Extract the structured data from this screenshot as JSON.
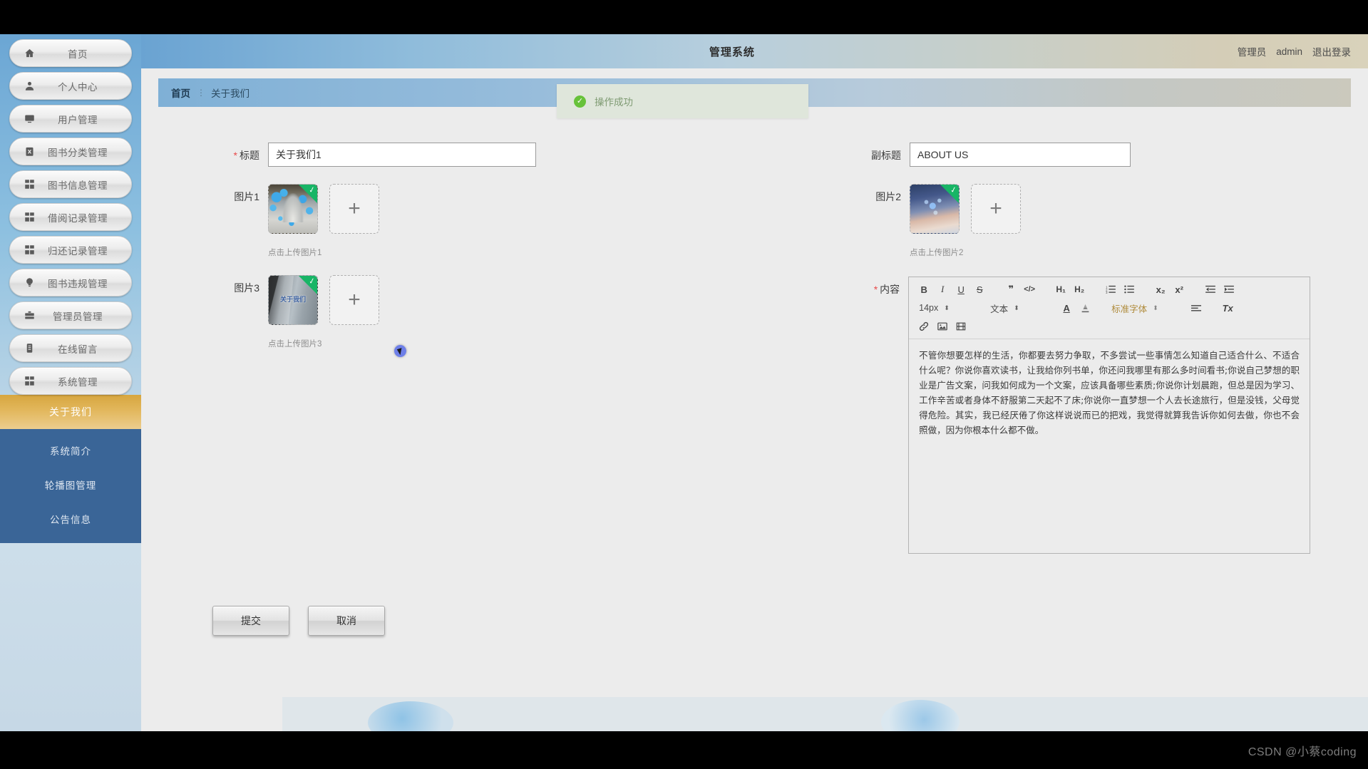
{
  "header": {
    "system_title": "管理系统",
    "role_label": "管理员",
    "username": "admin",
    "logout_label": "退出登录"
  },
  "toast": {
    "message": "操作成功",
    "icon": "check-circle-icon",
    "color": "#67c23a"
  },
  "breadcrumb": {
    "home": "首页",
    "separator": "⋮",
    "current": "关于我们"
  },
  "sidebar": {
    "items": [
      {
        "label": "首页",
        "icon": "home-icon"
      },
      {
        "label": "个人中心",
        "icon": "user-icon"
      },
      {
        "label": "用户管理",
        "icon": "monitor-icon"
      },
      {
        "label": "图书分类管理",
        "icon": "clipboard-x-icon"
      },
      {
        "label": "图书信息管理",
        "icon": "grid-icon"
      },
      {
        "label": "借阅记录管理",
        "icon": "grid-icon"
      },
      {
        "label": "归还记录管理",
        "icon": "grid-icon"
      },
      {
        "label": "图书违规管理",
        "icon": "bulb-icon"
      },
      {
        "label": "管理员管理",
        "icon": "briefcase-icon"
      },
      {
        "label": "在线留言",
        "icon": "clipboard-icon"
      },
      {
        "label": "系统管理",
        "icon": "grid-icon"
      }
    ],
    "active_group": "关于我们",
    "submenu": [
      {
        "label": "系统简介"
      },
      {
        "label": "轮播图管理"
      },
      {
        "label": "公告信息"
      }
    ],
    "active_color": "#d7a63f",
    "submenu_color": "#3a6597"
  },
  "form": {
    "title_field": {
      "label": "标题",
      "required": true,
      "value": "关于我们1",
      "placeholder": "标题"
    },
    "subtitle_field": {
      "label": "副标题",
      "required": false,
      "value": "ABOUT US",
      "placeholder": "副标题"
    },
    "image1": {
      "label": "图片1",
      "hint": "点击上传图片1",
      "add_icon": "plus-icon",
      "badge": "check-badge"
    },
    "image2": {
      "label": "图片2",
      "hint": "点击上传图片2",
      "add_icon": "plus-icon",
      "badge": "check-badge"
    },
    "image3": {
      "label": "图片3",
      "hint": "点击上传图片3",
      "add_icon": "plus-icon",
      "badge": "check-badge",
      "overlay_text": "关于我们"
    },
    "content_field": {
      "label": "内容",
      "required": true,
      "value": "不管你想要怎样的生活，你都要去努力争取，不多尝试一些事情怎么知道自己适合什么、不适合什么呢？你说你喜欢读书，让我给你列书单，你还问我哪里有那么多时间看书;你说自己梦想的职业是广告文案，问我如何成为一个文案，应该具备哪些素质;你说你计划晨跑，但总是因为学习、工作辛苦或者身体不舒服第二天起不了床;你说你一直梦想一个人去长途旅行，但是没钱，父母觉得危险。其实，我已经厌倦了你这样说说而已的把戏，我觉得就算我告诉你如何去做，你也不会照做，因为你根本什么都不做。"
    },
    "submit_label": "提交",
    "cancel_label": "取消"
  },
  "editor_toolbar": {
    "row1": [
      {
        "name": "bold-icon",
        "glyph": "B"
      },
      {
        "name": "italic-icon",
        "glyph": "I"
      },
      {
        "name": "underline-icon",
        "glyph": "U"
      },
      {
        "name": "strikethrough-icon",
        "glyph": "S"
      },
      {
        "name": "blockquote-icon",
        "glyph": "❞"
      },
      {
        "name": "code-icon",
        "glyph": "</>"
      },
      {
        "name": "heading1-icon",
        "glyph": "H₁"
      },
      {
        "name": "heading2-icon",
        "glyph": "H₂"
      },
      {
        "name": "ordered-list-icon",
        "glyph": "☰"
      },
      {
        "name": "bullet-list-icon",
        "glyph": "☰"
      },
      {
        "name": "subscript-icon",
        "glyph": "x₂"
      },
      {
        "name": "superscript-icon",
        "glyph": "x²"
      },
      {
        "name": "outdent-icon",
        "glyph": "⇤"
      },
      {
        "name": "indent-icon",
        "glyph": "⇥"
      }
    ],
    "font_size": "14px",
    "block_type": "文本",
    "font_color_icon": "font-color-icon",
    "highlight_icon": "highlight-icon",
    "font_family": "标准字体",
    "align_icon": "align-icon",
    "clear-format-icon": "Tx",
    "row3": [
      {
        "name": "link-icon",
        "glyph": "🔗"
      },
      {
        "name": "insert-image-icon",
        "glyph": "🖼"
      },
      {
        "name": "insert-video-icon",
        "glyph": "🎞"
      }
    ]
  },
  "watermark": {
    "text": "CSDN @小蔡coding"
  }
}
